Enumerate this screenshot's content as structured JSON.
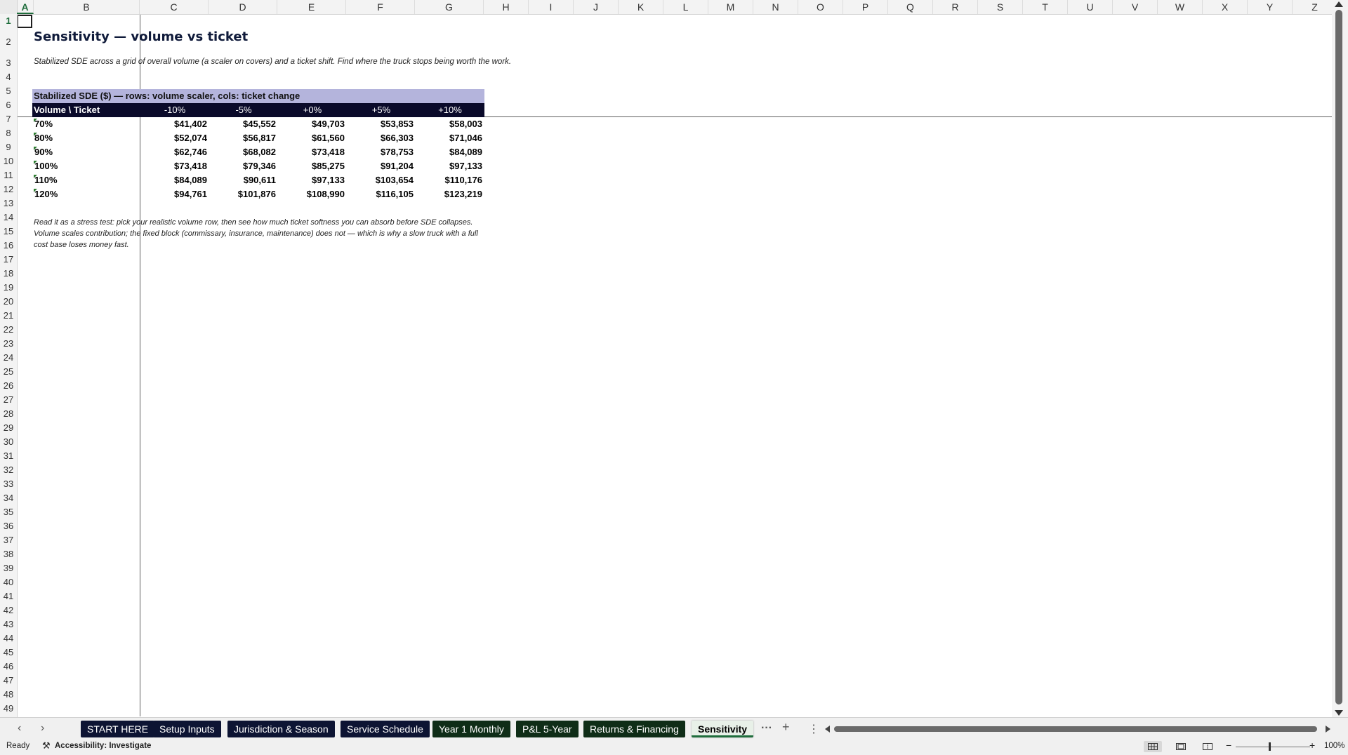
{
  "columns": [
    "A",
    "B",
    "C",
    "D",
    "E",
    "F",
    "G",
    "H",
    "I",
    "J",
    "K",
    "L",
    "M",
    "N",
    "O",
    "P",
    "Q",
    "R",
    "S",
    "T",
    "U",
    "V",
    "W",
    "X",
    "Y",
    "Z"
  ],
  "rows": [
    1,
    2,
    3,
    4,
    5,
    6,
    7,
    8,
    9,
    10,
    11,
    12,
    13,
    14,
    15,
    16,
    17,
    18,
    19,
    20,
    21,
    22,
    23,
    24,
    25,
    26,
    27,
    28,
    29,
    30,
    31,
    32,
    33,
    34,
    35,
    36,
    37,
    38,
    39,
    40,
    41,
    42,
    43,
    44,
    45,
    46,
    47,
    48,
    49
  ],
  "sheet": {
    "title": "Sensitivity — volume vs ticket",
    "subtitle": "Stabilized SDE across a grid of overall volume (a scaler on covers) and a ticket shift. Find where the truck stops being worth the work.",
    "table_title": "Stabilized SDE ($) — rows: volume scaler, cols: ticket change",
    "corner_label": "Volume \\ Ticket",
    "col_headers": [
      "-10%",
      "-5%",
      "+0%",
      "+5%",
      "+10%"
    ],
    "table_rows": [
      {
        "label": "70%",
        "values": [
          "$41,402",
          "$45,552",
          "$49,703",
          "$53,853",
          "$58,003"
        ]
      },
      {
        "label": "80%",
        "values": [
          "$52,074",
          "$56,817",
          "$61,560",
          "$66,303",
          "$71,046"
        ]
      },
      {
        "label": "90%",
        "values": [
          "$62,746",
          "$68,082",
          "$73,418",
          "$78,753",
          "$84,089"
        ]
      },
      {
        "label": "100%",
        "values": [
          "$73,418",
          "$79,346",
          "$85,275",
          "$91,204",
          "$97,133"
        ]
      },
      {
        "label": "110%",
        "values": [
          "$84,089",
          "$90,611",
          "$97,133",
          "$103,654",
          "$110,176"
        ]
      },
      {
        "label": "120%",
        "values": [
          "$94,761",
          "$101,876",
          "$108,990",
          "$116,105",
          "$123,219"
        ]
      }
    ],
    "note": "Read it as a stress test: pick your realistic volume row, then see how much ticket softness you can absorb before SDE collapses. Volume scales contribution; the fixed block (commissary, insurance, maintenance) does not — which is why a slow truck with a full cost base loses money fast."
  },
  "tabs": [
    {
      "label": "START HERE",
      "style": "navy"
    },
    {
      "label": "Setup Inputs",
      "style": "navy"
    },
    {
      "label": "Jurisdiction & Season",
      "style": "navy"
    },
    {
      "label": "Service Schedule",
      "style": "navy"
    },
    {
      "label": "Year 1 Monthly",
      "style": "green"
    },
    {
      "label": "P&L 5-Year",
      "style": "green"
    },
    {
      "label": "Returns & Financing",
      "style": "green"
    },
    {
      "label": "Sensitivity",
      "style": "active"
    }
  ],
  "tabbar": {
    "more_icon": "ellipsis-icon",
    "add_icon": "plus-icon",
    "options_icon": "vertical-dots-icon",
    "more_label": "···",
    "add_label": "+",
    "options_label": "⋮"
  },
  "status": {
    "ready": "Ready",
    "accessibility": "Accessibility: Investigate",
    "zoom": "100%"
  },
  "colors": {
    "header_navy": "#0a0a2a",
    "band": "#b4b4dc",
    "accent_green": "#1f6d3c"
  }
}
